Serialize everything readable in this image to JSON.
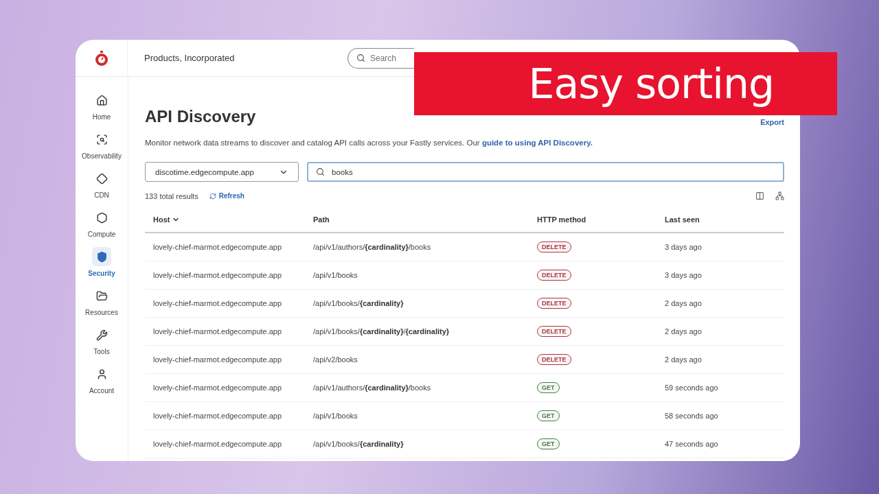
{
  "topbar": {
    "company": "Products, Incorporated",
    "search": {
      "placeholder": "Search"
    }
  },
  "sidebar": {
    "items": [
      {
        "label": "Home",
        "selected": false
      },
      {
        "label": "Observability",
        "selected": false
      },
      {
        "label": "CDN",
        "selected": false
      },
      {
        "label": "Compute",
        "selected": false
      },
      {
        "label": "Security",
        "selected": true
      },
      {
        "label": "Resources",
        "selected": false
      },
      {
        "label": "Tools",
        "selected": false
      },
      {
        "label": "Account",
        "selected": false
      }
    ]
  },
  "page": {
    "title": "API Discovery",
    "export": "Export",
    "description": "Monitor network data streams to discover and catalog API calls across your Fastly services. Our",
    "guide_link": "guide to using API Discovery.",
    "service_select": "discotime.edgecompute.app",
    "filter": {
      "value": "books"
    },
    "total": "133 total results",
    "refresh": "Refresh"
  },
  "table": {
    "columns": [
      {
        "label": "Host",
        "sorted": true
      },
      {
        "label": "Path",
        "sorted": false
      },
      {
        "label": "HTTP method",
        "sorted": false
      },
      {
        "label": "Last seen",
        "sorted": false
      }
    ],
    "rows": [
      {
        "host": "lovely-chief-marmot.edgecompute.app",
        "path": "/api/v1/authors/**{cardinality}**/books",
        "method": {
          "label": "DELETE",
          "kind": "delete"
        },
        "last_seen": "3 days ago"
      },
      {
        "host": "lovely-chief-marmot.edgecompute.app",
        "path": "/api/v1/books",
        "method": {
          "label": "DELETE",
          "kind": "delete"
        },
        "last_seen": "3 days ago"
      },
      {
        "host": "lovely-chief-marmot.edgecompute.app",
        "path": "/api/v1/books/**{cardinality}**",
        "method": {
          "label": "DELETE",
          "kind": "delete"
        },
        "last_seen": "2 days ago"
      },
      {
        "host": "lovely-chief-marmot.edgecompute.app",
        "path": "/api/v1/books/**{cardinality}**/**{cardinality}**",
        "method": {
          "label": "DELETE",
          "kind": "delete"
        },
        "last_seen": "2 days ago"
      },
      {
        "host": "lovely-chief-marmot.edgecompute.app",
        "path": "/api/v2/books",
        "method": {
          "label": "DELETE",
          "kind": "delete"
        },
        "last_seen": "2 days ago"
      },
      {
        "host": "lovely-chief-marmot.edgecompute.app",
        "path": "/api/v1/authors/**{cardinality}**/books",
        "method": {
          "label": "GET",
          "kind": "get"
        },
        "last_seen": "59 seconds ago"
      },
      {
        "host": "lovely-chief-marmot.edgecompute.app",
        "path": "/api/v1/books",
        "method": {
          "label": "GET",
          "kind": "get"
        },
        "last_seen": "58 seconds ago"
      },
      {
        "host": "lovely-chief-marmot.edgecompute.app",
        "path": "/api/v1/books/**{cardinality}**",
        "method": {
          "label": "GET",
          "kind": "get"
        },
        "last_seen": "47 seconds ago"
      }
    ]
  },
  "banner": {
    "text": "Easy sorting"
  }
}
